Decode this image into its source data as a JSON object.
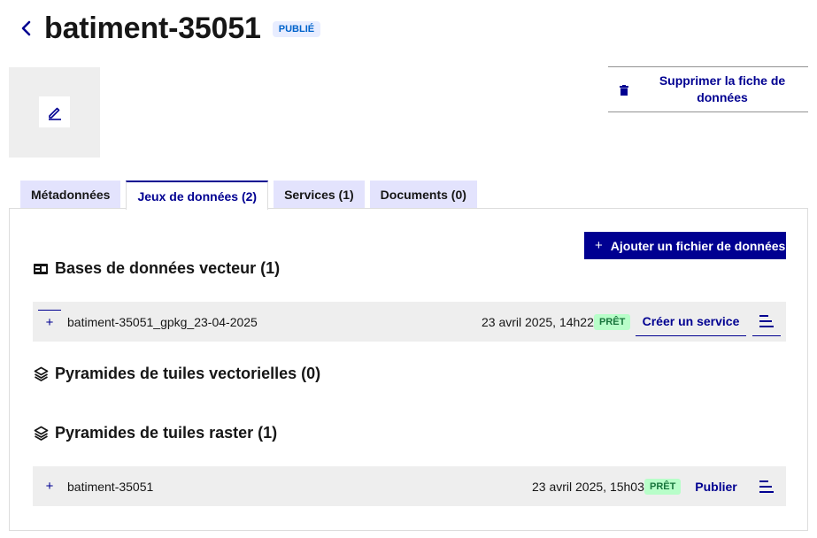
{
  "header": {
    "title": "batiment-35051",
    "status": "PUBLIÉ"
  },
  "actions": {
    "delete_label": "Supprimer la fiche de données"
  },
  "tabs": [
    {
      "label": "Métadonnées"
    },
    {
      "label": "Jeux de données (2)"
    },
    {
      "label": "Services (1)"
    },
    {
      "label": "Documents (0)"
    }
  ],
  "panel": {
    "add_label": "Ajouter un fichier de données",
    "sections": [
      {
        "title": "Bases de données vecteur (1)",
        "icon": "database-icon",
        "rows": [
          {
            "name": "batiment-35051_gpkg_23-04-2025",
            "date": "23 avril 2025, 14h22",
            "status": "PRÊT",
            "action": "Créer un service"
          }
        ]
      },
      {
        "title": "Pyramides de tuiles vectorielles (0)",
        "icon": "layers-icon",
        "rows": []
      },
      {
        "title": "Pyramides de tuiles raster (1)",
        "icon": "layers-icon",
        "rows": [
          {
            "name": "batiment-35051",
            "date": "23 avril 2025, 15h03",
            "status": "PRÊT",
            "action": "Publier"
          }
        ]
      }
    ]
  },
  "colors": {
    "accent": "#000091",
    "tab_bg": "#e3e3fd",
    "badge_published_bg": "#e8edff",
    "badge_published_text": "#0063cb",
    "badge_ready_bg": "#b8fec9",
    "badge_ready_text": "#18753c",
    "row_bg": "#eeeeee"
  }
}
